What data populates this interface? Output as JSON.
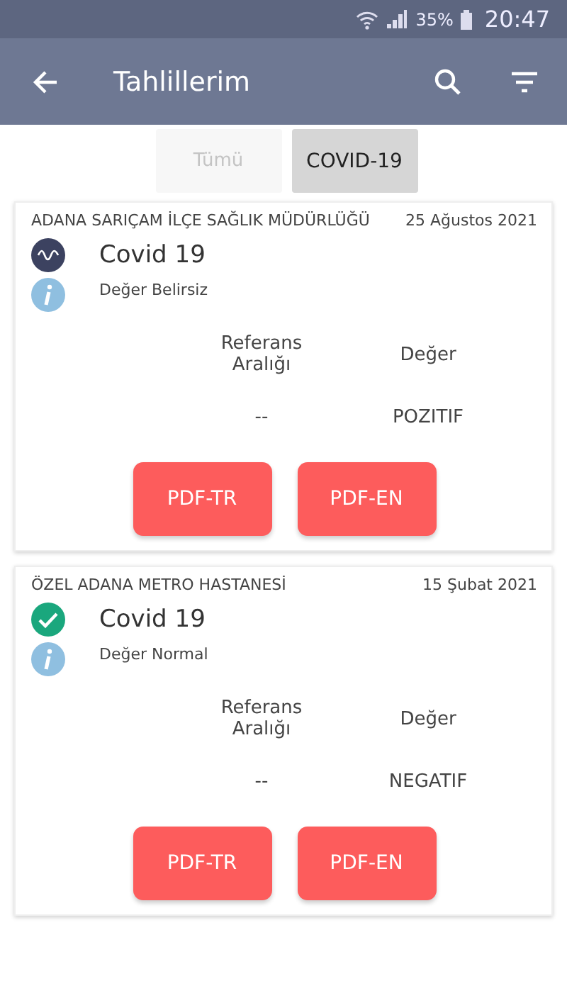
{
  "status_bar": {
    "battery": "35%",
    "time": "20:47"
  },
  "app_bar": {
    "title": "Tahlillerim"
  },
  "tabs": [
    {
      "label": "Tümü",
      "selected": false
    },
    {
      "label": "COVID-19",
      "selected": true
    }
  ],
  "results": [
    {
      "institution": "ADANA SARIÇAM İLÇE SAĞLIK MÜDÜRLÜĞÜ",
      "date": "25 Ağustos 2021",
      "test": "Covid 19",
      "kind": "wave",
      "note": "Değer Belirsiz",
      "reference_header": "Referans Aralığı",
      "value_header": "Değer",
      "reference": "--",
      "value": "POZITIF",
      "buttons": [
        "PDF-TR",
        "PDF-EN"
      ]
    },
    {
      "institution": "ÖZEL ADANA METRO HASTANESİ",
      "date": "15 Şubat 2021",
      "test": "Covid 19",
      "kind": "check",
      "note": "Değer Normal",
      "reference_header": "Referans Aralığı",
      "value_header": "Değer",
      "reference": "--",
      "value": "NEGATIF",
      "buttons": [
        "PDF-TR",
        "PDF-EN"
      ]
    }
  ]
}
